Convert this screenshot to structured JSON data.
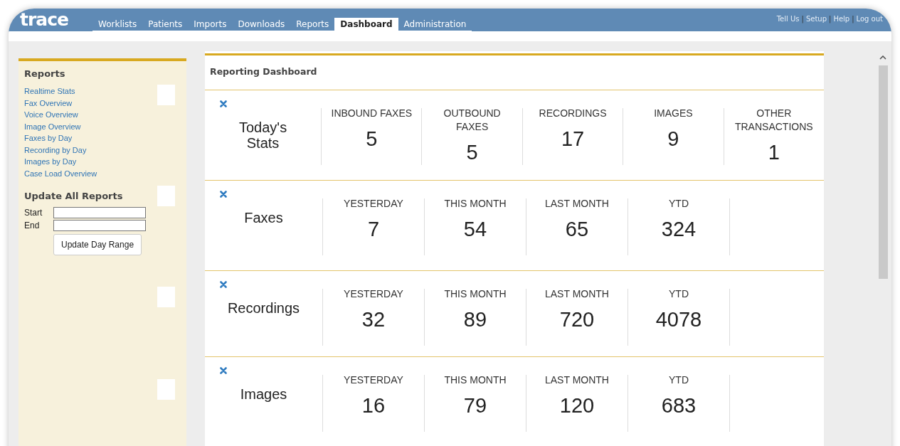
{
  "logo": "trace",
  "nav": [
    {
      "label": "Worklists",
      "selected": false
    },
    {
      "label": "Patients",
      "selected": false
    },
    {
      "label": "Imports",
      "selected": false
    },
    {
      "label": "Downloads",
      "selected": false
    },
    {
      "label": "Reports",
      "selected": false
    },
    {
      "label": "Dashboard",
      "selected": true
    },
    {
      "label": "Administration",
      "selected": false
    }
  ],
  "header_links": [
    "Tell Us",
    "Setup",
    "Help",
    "Log out"
  ],
  "header_separator": "|",
  "sidebar": {
    "reports_title": "Reports",
    "report_links": [
      "Realtime Stats",
      "Fax Overview",
      "Voice Overview",
      "Image Overview",
      "Faxes by Day",
      "Recording by Day",
      "Images by Day",
      "Case Load Overview"
    ],
    "update_title": "Update All Reports",
    "fields": [
      {
        "label": "Start"
      },
      {
        "label": "End"
      }
    ],
    "update_button": "Update Day Range"
  },
  "dashboard": {
    "title": "Reporting Dashboard",
    "sections": [
      {
        "title": "Today's Stats",
        "stats": [
          {
            "label": "INBOUND FAXES",
            "value": "5"
          },
          {
            "label": "OUTBOUND FAXES",
            "value": "5"
          },
          {
            "label": "RECORDINGS",
            "value": "17"
          },
          {
            "label": "IMAGES",
            "value": "9"
          },
          {
            "label": "OTHER TRANSACTIONS",
            "value": "1"
          }
        ]
      },
      {
        "title": "Faxes",
        "stats": [
          {
            "label": "YESTERDAY",
            "value": "7"
          },
          {
            "label": "THIS MONTH",
            "value": "54"
          },
          {
            "label": "LAST MONTH",
            "value": "65"
          },
          {
            "label": "YTD",
            "value": "324"
          }
        ]
      },
      {
        "title": "Recordings",
        "stats": [
          {
            "label": "YESTERDAY",
            "value": "32"
          },
          {
            "label": "THIS MONTH",
            "value": "89"
          },
          {
            "label": "LAST MONTH",
            "value": "720"
          },
          {
            "label": "YTD",
            "value": "4078"
          }
        ]
      },
      {
        "title": "Images",
        "stats": [
          {
            "label": "YESTERDAY",
            "value": "16"
          },
          {
            "label": "THIS MONTH",
            "value": "79"
          },
          {
            "label": "LAST MONTH",
            "value": "120"
          },
          {
            "label": "YTD",
            "value": "683"
          }
        ]
      }
    ]
  }
}
